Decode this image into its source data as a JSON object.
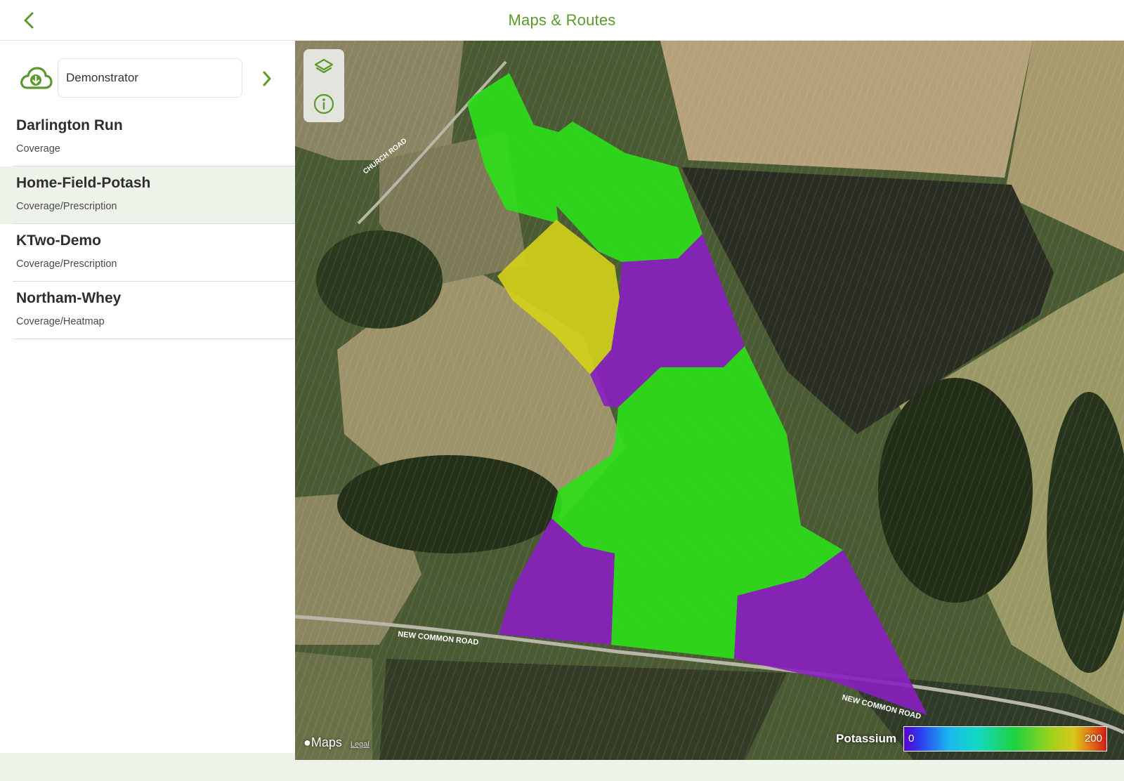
{
  "header": {
    "title": "Maps & Routes",
    "back_icon": "chevron-left-icon"
  },
  "sidebar": {
    "cloud_icon": "cloud-download-icon",
    "account": "Demonstrator",
    "next_icon": "chevron-right-icon",
    "routes": [
      {
        "name": "Darlington Run",
        "type": "Coverage",
        "selected": false
      },
      {
        "name": "Home-Field-Potash",
        "type": "Coverage/Prescription",
        "selected": true
      },
      {
        "name": "KTwo-Demo",
        "type": "Coverage/Prescription",
        "selected": false
      },
      {
        "name": "Northam-Whey",
        "type": "Coverage/Heatmap",
        "selected": false
      }
    ]
  },
  "map": {
    "controls": [
      "layers-icon",
      "info-icon"
    ],
    "attribution": "Maps",
    "legal": "Legal",
    "road_labels": [
      "CHURCH ROAD",
      "NEW COMMON ROAD",
      "NEW COMMON ROAD"
    ],
    "zone_colors": {
      "green": "#2ee01a",
      "purple": "#8a1fc0",
      "yellow": "#d4d21a"
    },
    "legend": {
      "label": "Potassium",
      "min": "0",
      "max": "200"
    }
  },
  "colors": {
    "accent": "#5a9a2c",
    "selected_row": "#eef3ea"
  }
}
